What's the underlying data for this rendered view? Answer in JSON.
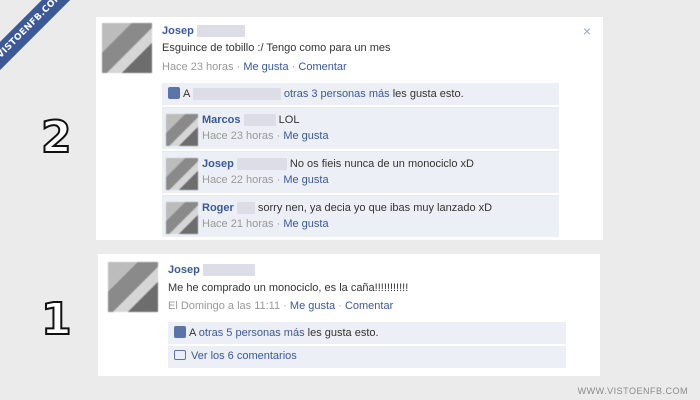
{
  "watermark_corner": "VISTOENFB.COM",
  "watermark_bottom": "WWW.VISTOENFB.COM",
  "labels": {
    "post2_number": "2",
    "post1_number": "1"
  },
  "post2": {
    "author": "Josep",
    "text": "Esguince de tobillo :/ Tengo como para un mes",
    "time": "Hace 23 horas",
    "like_link": "Me gusta",
    "comment_link": "Comentar",
    "close": "×",
    "likes": {
      "prefix": "A",
      "others_link": "otras 3 personas más",
      "suffix": "les gusta esto."
    },
    "comments": [
      {
        "author": "Marcos",
        "text": "LOL",
        "time": "Hace 23 horas",
        "like_link": "Me gusta"
      },
      {
        "author": "Josep",
        "text": "No os fieis nunca de un monociclo xD",
        "time": "Hace 22 horas",
        "like_link": "Me gusta"
      },
      {
        "author": "Roger",
        "text": "sorry nen, ya decia yo que ibas muy lanzado xD",
        "time": "Hace 21 horas",
        "like_link": "Me gusta"
      }
    ]
  },
  "post1": {
    "author": "Josep",
    "text": "Me he comprado un monociclo, es la caña!!!!!!!!!!!",
    "time": "El Domingo a las 11:11",
    "like_link": "Me gusta",
    "comment_link": "Comentar",
    "likes": {
      "prefix": "A",
      "others_link": "otras 5 personas más",
      "suffix": "les gusta esto."
    },
    "view_comments": "Ver los 6 comentarios"
  },
  "icons": [
    "thumbs-up-icon",
    "speech-bubble-icon",
    "close-icon"
  ],
  "colors": {
    "link": "#3b5998",
    "meta": "#999999",
    "panel": "#eceff5",
    "ribbon": "#3b5998"
  }
}
